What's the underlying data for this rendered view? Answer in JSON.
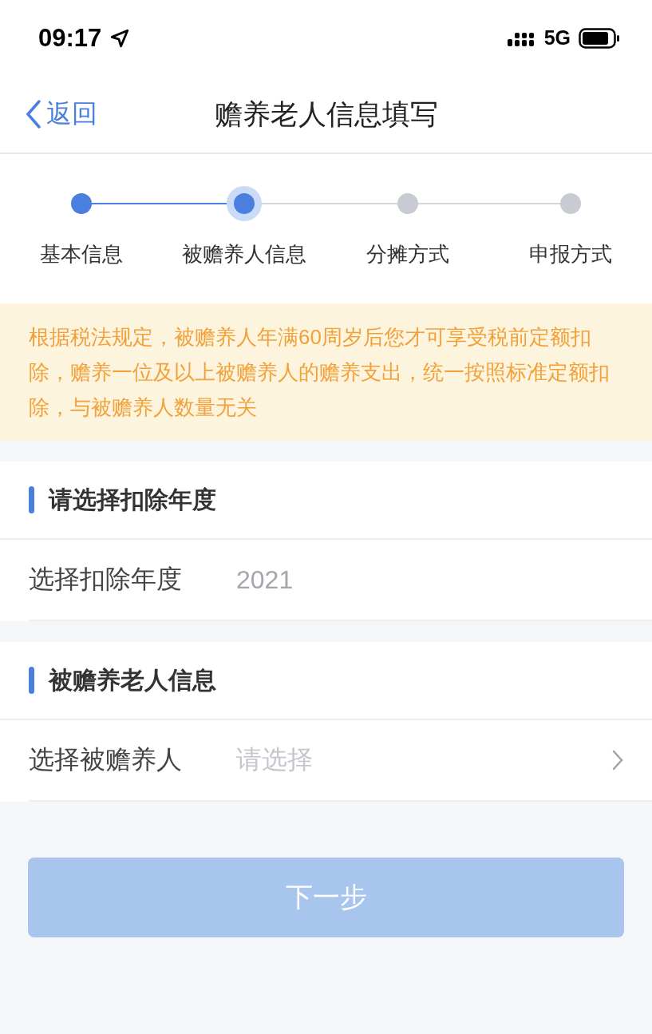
{
  "status_bar": {
    "time": "09:17",
    "network": "5G"
  },
  "nav": {
    "back": "返回",
    "title": "赡养老人信息填写"
  },
  "steps": [
    {
      "label": "基本信息",
      "completed": true,
      "selected": false
    },
    {
      "label": "被赡养人信息",
      "completed": false,
      "selected": true
    },
    {
      "label": "分摊方式",
      "completed": false,
      "selected": false
    },
    {
      "label": "申报方式",
      "completed": false,
      "selected": false
    }
  ],
  "notice": "根据税法规定，被赡养人年满60周岁后您才可享受税前定额扣除，赡养一位及以上被赡养人的赡养支出，统一按照标准定额扣除，与被赡养人数量无关",
  "sections": [
    {
      "title": "请选择扣除年度",
      "rows": [
        {
          "kind": "value",
          "label": "选择扣除年度",
          "value": "2021"
        }
      ]
    },
    {
      "title": "被赡养老人信息",
      "rows": [
        {
          "kind": "picker",
          "label": "选择被赡养人",
          "placeholder": "请选择"
        }
      ]
    }
  ],
  "next_button": {
    "label": "下一步",
    "disabled": true
  }
}
